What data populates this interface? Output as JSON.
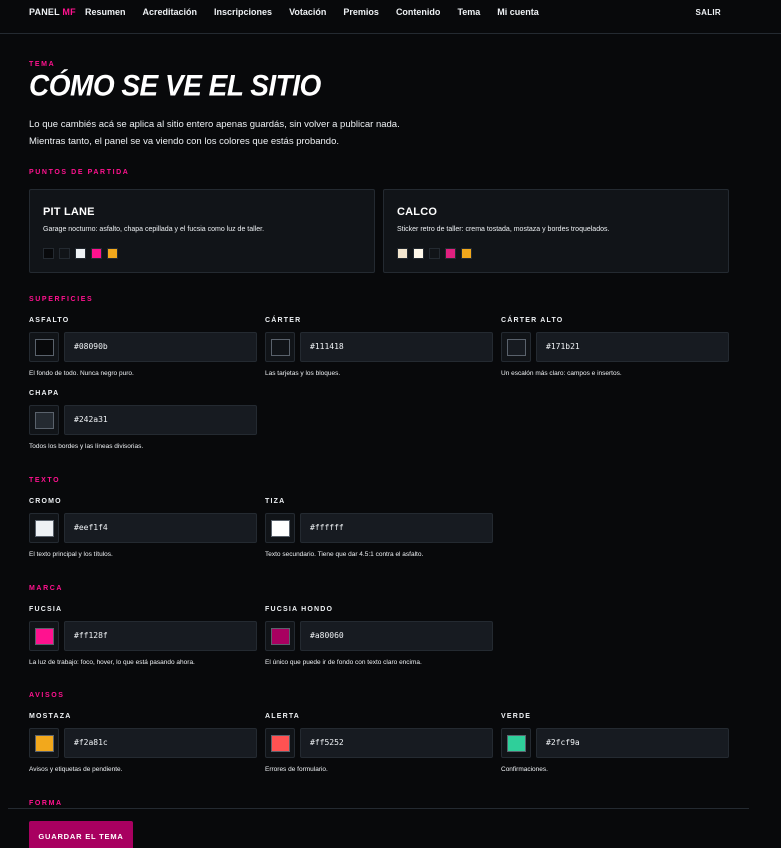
{
  "nav": {
    "brand_main": "PANEL",
    "brand_accent": "MF",
    "links": [
      "Resumen",
      "Acreditación",
      "Inscripciones",
      "Votación",
      "Premios",
      "Contenido",
      "Tema",
      "Mi cuenta"
    ],
    "logout": "SALIR"
  },
  "header": {
    "eyebrow": "TEMA",
    "title": "CÓMO SE VE EL SITIO",
    "description": "Lo que cambiés acá se aplica al sitio entero apenas guardás, sin volver a publicar nada. Mientras tanto, el panel se va viendo con los colores que estás probando."
  },
  "presets": {
    "section_label": "PUNTOS DE PARTIDA",
    "items": [
      {
        "name": "PIT LANE",
        "description": "Garage nocturno: asfalto, chapa cepillada y el fucsia como luz de taller.",
        "swatches": [
          "#08090b",
          "#111418",
          "#eef1f4",
          "#ff128f",
          "#f2a81c"
        ]
      },
      {
        "name": "CALCO",
        "description": "Sticker retro de taller: crema tostada, mostaza y bordes troquelados.",
        "swatches": [
          "#f3e6cf",
          "#fff8ea",
          "#111418",
          "#e0207f",
          "#f2a81c"
        ]
      }
    ]
  },
  "sections": {
    "superficies": {
      "label": "SUPERFICIES",
      "fields": [
        {
          "label": "ASFALTO",
          "value": "#08090b",
          "help": "El fondo de todo. Nunca negro puro."
        },
        {
          "label": "CÁRTER",
          "value": "#111418",
          "help": "Las tarjetas y los bloques."
        },
        {
          "label": "CÁRTER ALTO",
          "value": "#171b21",
          "help": "Un escalón más claro: campos e insertos."
        },
        {
          "label": "CHAPA",
          "value": "#242a31",
          "help": "Todos los bordes y las líneas divisorias."
        }
      ]
    },
    "texto": {
      "label": "TEXTO",
      "fields": [
        {
          "label": "CROMO",
          "value": "#eef1f4",
          "help": "El texto principal y los títulos."
        },
        {
          "label": "TIZA",
          "value": "#ffffff",
          "help": "Texto secundario. Tiene que dar 4.5:1 contra el asfalto."
        }
      ]
    },
    "marca": {
      "label": "MARCA",
      "fields": [
        {
          "label": "FUCSIA",
          "value": "#ff128f",
          "help": "La luz de trabajo: foco, hover, lo que está pasando ahora."
        },
        {
          "label": "FUCSIA HONDO",
          "value": "#a80060",
          "help": "El único que puede ir de fondo con texto claro encima."
        }
      ]
    },
    "avisos": {
      "label": "AVISOS",
      "fields": [
        {
          "label": "MOSTAZA",
          "value": "#f2a81c",
          "help": "Avisos y etiquetas de pendiente."
        },
        {
          "label": "ALERTA",
          "value": "#ff5252",
          "help": "Errores de formulario."
        },
        {
          "label": "VERDE",
          "value": "#2fcf9a",
          "help": "Confirmaciones."
        }
      ]
    },
    "forma": {
      "label": "FORMA"
    }
  },
  "actions": {
    "save_label": "GUARDAR EL TEMA"
  }
}
